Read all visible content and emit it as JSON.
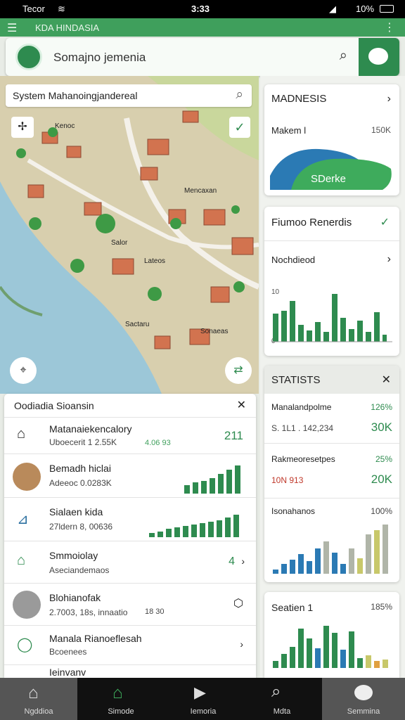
{
  "status": {
    "carrier": "Tecor",
    "time": "3:33",
    "battery": "10%"
  },
  "appbar": {
    "title": "KDA HINDASIA"
  },
  "search": {
    "value": "Somajno jemenia"
  },
  "map": {
    "search_value": "System Mahanoingjandereal",
    "labels": [
      "Kenoc",
      "Mencaxan",
      "Salor",
      "Lateos",
      "Sactaru",
      "Sonaeas"
    ]
  },
  "list_card": {
    "title": "Oodiadia Sioansin",
    "items": [
      {
        "name": "Matanaiekencalory",
        "sub": "Uboecerit 1 2.55K",
        "extra": "4.06 93",
        "value": "211"
      },
      {
        "name": "Bemadh hiclai",
        "sub": "Adeeoc 0.0283K"
      },
      {
        "name": "Sialaen kida",
        "sub": "27ldern 8, 00636"
      },
      {
        "name": "Smmoiolay",
        "sub": "Aseciandemaos",
        "value": "4"
      },
      {
        "name": "Blohianofak",
        "sub": "2.7003, 18s, innaatio",
        "extra": "18 30"
      },
      {
        "name": "Manala Rianoeflesah",
        "sub": "Bcoenees"
      },
      {
        "name": "Ieinvanv"
      }
    ]
  },
  "side": {
    "card1": {
      "title": "MADNESIS",
      "sub": "Makem l",
      "sub_val": "150K",
      "badge": "SDerke"
    },
    "card2": {
      "title": "Fiumoo Renerdis",
      "sub": "Nochdieod",
      "axis_top": "10",
      "axis_bottom": "0"
    },
    "card3": {
      "title": "STATISTS",
      "r1_name": "Manalandpolme",
      "r1_pct": "126%",
      "r1_sub": "S. 1L1 . 142,234",
      "r1_val": "30K",
      "r2_name": "Rakmeoresetpes",
      "r2_pct": "25%",
      "r2_sub": "10N 913",
      "r2_val": "20K",
      "r3_name": "Isonahanos",
      "r3_pct": "100%"
    },
    "card4": {
      "title": "Seatien 1",
      "pct": "185%"
    }
  },
  "nav": {
    "items": [
      "Ngddioa",
      "Simode",
      "Iemoria",
      "Mdta",
      "Semmina"
    ]
  },
  "colors": {
    "accent": "#2e8b4f",
    "accent_light": "#3f9f5c",
    "water": "#9cc7d8",
    "land": "#d8cfae"
  }
}
